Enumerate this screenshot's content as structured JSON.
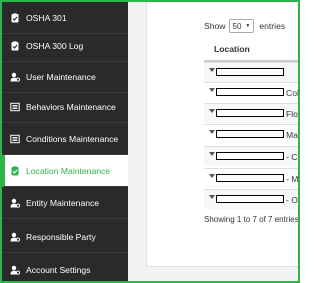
{
  "sidebar": {
    "items": [
      {
        "label": "OSHA 301",
        "icon": "clipboard-check-icon",
        "active": false
      },
      {
        "label": "OSHA 300 Log",
        "icon": "clipboard-check-icon",
        "active": false
      },
      {
        "label": "User Maintenance",
        "icon": "user-gear-icon",
        "active": false
      },
      {
        "label": "Behaviors Maintenance",
        "icon": "list-box-icon",
        "active": false
      },
      {
        "label": "Conditions Maintenance",
        "icon": "list-box-icon",
        "active": false
      },
      {
        "label": "Location Maintenance",
        "icon": "clipboard-check-icon",
        "active": true
      },
      {
        "label": "Entity Maintenance",
        "icon": "user-gear-icon",
        "active": false
      },
      {
        "label": "Responsible Party",
        "icon": "user-gear-icon",
        "active": false
      },
      {
        "label": "Account Settings",
        "icon": "user-gear-icon",
        "active": false
      }
    ]
  },
  "table": {
    "show_label": "Show",
    "page_size": "50",
    "entries_label": "entries",
    "column_header": "Location",
    "rows": [
      "",
      "Colo",
      "Flori",
      "Mair",
      "- Ca",
      "- Ma",
      "- Of"
    ],
    "info": "Showing 1 to 7 of 7 entries"
  },
  "colors": {
    "accent": "#2fb44a",
    "sidebar_bg": "#2a2a2a"
  }
}
